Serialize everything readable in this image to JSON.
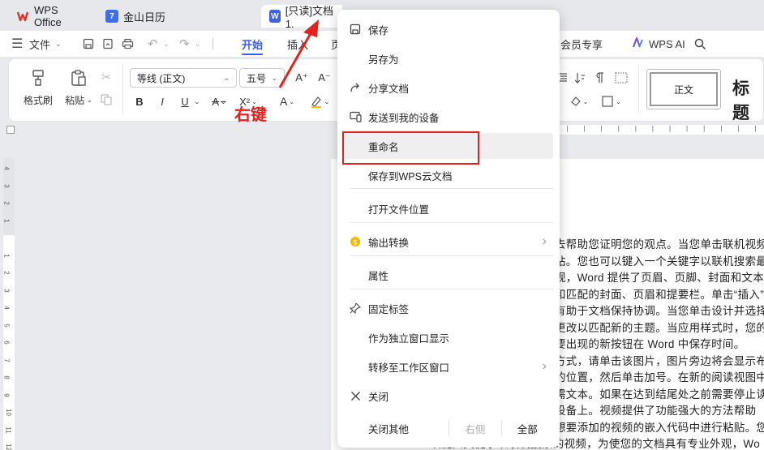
{
  "tabs": [
    {
      "label": "WPS Office",
      "icon": "wps-logo-icon"
    },
    {
      "label": "金山日历",
      "icon": "calendar-icon"
    },
    {
      "label": "[只读]文档1.",
      "icon": "word-doc-icon"
    }
  ],
  "menubar": {
    "file": "文件",
    "start": "开始",
    "insert": "插入",
    "page": "页",
    "vip": "会员专享",
    "wps_ai": "WPS AI"
  },
  "ribbon": {
    "format_painter": "格式刷",
    "paste": "粘贴",
    "font_name": "等线 (正文)",
    "font_size": "五号",
    "bold": "B",
    "italic": "I",
    "underline": "U",
    "style_normal": "正文",
    "style_heading": "标题"
  },
  "ruler": {
    "vertical_numbers": [
      "4",
      "3",
      "2",
      "1",
      "",
      "1",
      "2",
      "3",
      "4",
      "5",
      "6",
      "7",
      "8",
      "9",
      "10",
      "11",
      "12"
    ]
  },
  "annotation": {
    "label": "右键"
  },
  "context_menu": {
    "items": [
      {
        "label": "保存",
        "icon": "save-icon"
      },
      {
        "label": "另存为",
        "icon": ""
      },
      {
        "label": "分享文档",
        "icon": "share-icon"
      },
      {
        "label": "发送到我的设备",
        "icon": "device-icon"
      },
      {
        "label": "重命名",
        "icon": ""
      },
      {
        "label": "保存到WPS云文档",
        "icon": ""
      },
      {
        "label": "打开文件位置",
        "icon": ""
      },
      {
        "label": "输出转换",
        "icon": "convert-icon"
      },
      {
        "label": "属性",
        "icon": ""
      },
      {
        "label": "固定标签",
        "icon": "pin-icon"
      },
      {
        "label": "作为独立窗口显示",
        "icon": ""
      },
      {
        "label": "转移至工作区窗口",
        "icon": ""
      },
      {
        "label": "关闭",
        "icon": "close-icon"
      }
    ],
    "close_others": "关闭其他",
    "right_side": "右侧",
    "all": "全部"
  },
  "document": {
    "lines": [
      "去帮助您证明您的观点。当您单击联机视频",
      "钻。您也可以键入一个关键字以联机搜索最",
      "观，Word 提供了页眉、页脚、封面和文本",
      "和匹配的封面、页眉和提要栏。单击“插入”",
      "有助于文档保持协调。当您单击设计并选择",
      "更改以匹配新的主题。当应用样式时，您的",
      "要出现的新按钮在 Word 中保存时间。",
      "方式，请单击该图片，图片旁边将会显示布",
      "的位置，然后单击加号。在新的阅读视图中",
      "需文本。如果在达到结尾处之前需要停止读",
      "设备上。视频提供了功能强大的方法帮助",
      "想要添加的视频的嵌入代码中进行粘贴。您",
      "以键入关键字以联机搜索的视频，为使您的文档具有专业外观，Wo"
    ]
  },
  "colors": {
    "accent": "#3b5df0",
    "annotation_red": "#e0231f"
  }
}
